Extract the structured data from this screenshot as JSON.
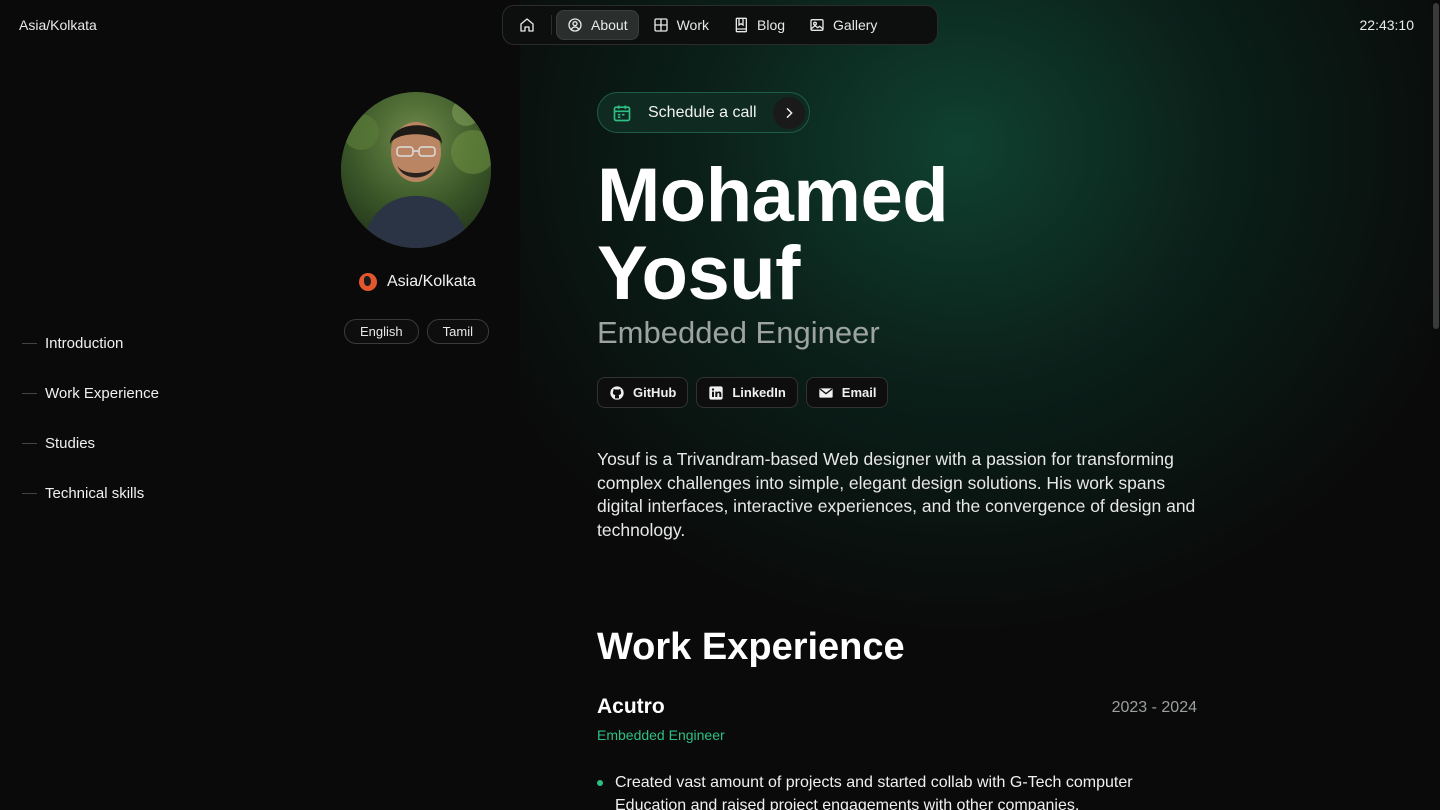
{
  "header": {
    "timezone": "Asia/Kolkata",
    "time": "22:43:10"
  },
  "nav": {
    "home_icon": "home-icon",
    "items": [
      {
        "label": "About",
        "icon": "user-circle-icon",
        "active": true
      },
      {
        "label": "Work",
        "icon": "grid-icon",
        "active": false
      },
      {
        "label": "Blog",
        "icon": "book-icon",
        "active": false
      },
      {
        "label": "Gallery",
        "icon": "image-icon",
        "active": false
      }
    ]
  },
  "toc": {
    "items": [
      {
        "label": "Introduction"
      },
      {
        "label": "Work Experience"
      },
      {
        "label": "Studies"
      },
      {
        "label": "Technical skills"
      }
    ]
  },
  "profile": {
    "location": "Asia/Kolkata",
    "languages": [
      "English",
      "Tamil"
    ]
  },
  "hero": {
    "schedule_label": "Schedule a call",
    "name_line1": "Mohamed",
    "name_line2": "Yosuf",
    "role": "Embedded Engineer",
    "socials": [
      {
        "label": "GitHub",
        "icon": "github-icon"
      },
      {
        "label": "LinkedIn",
        "icon": "linkedin-icon"
      },
      {
        "label": "Email",
        "icon": "mail-icon"
      }
    ],
    "bio": "Yosuf is a Trivandram-based Web designer with a passion for transforming complex challenges into simple, elegant design solutions. His work spans digital interfaces, interactive experiences, and the convergence of design and technology."
  },
  "work": {
    "title": "Work Experience",
    "jobs": [
      {
        "company": "Acutro",
        "years": "2023 - 2024",
        "role": "Embedded Engineer",
        "bullets": [
          "Created vast amount of projects and started collab with G-Tech computer Education and raised project engagements with other companies."
        ]
      }
    ]
  },
  "colors": {
    "accent": "#2fbf83",
    "background": "#0a0a0a",
    "glow": "#146e50"
  }
}
